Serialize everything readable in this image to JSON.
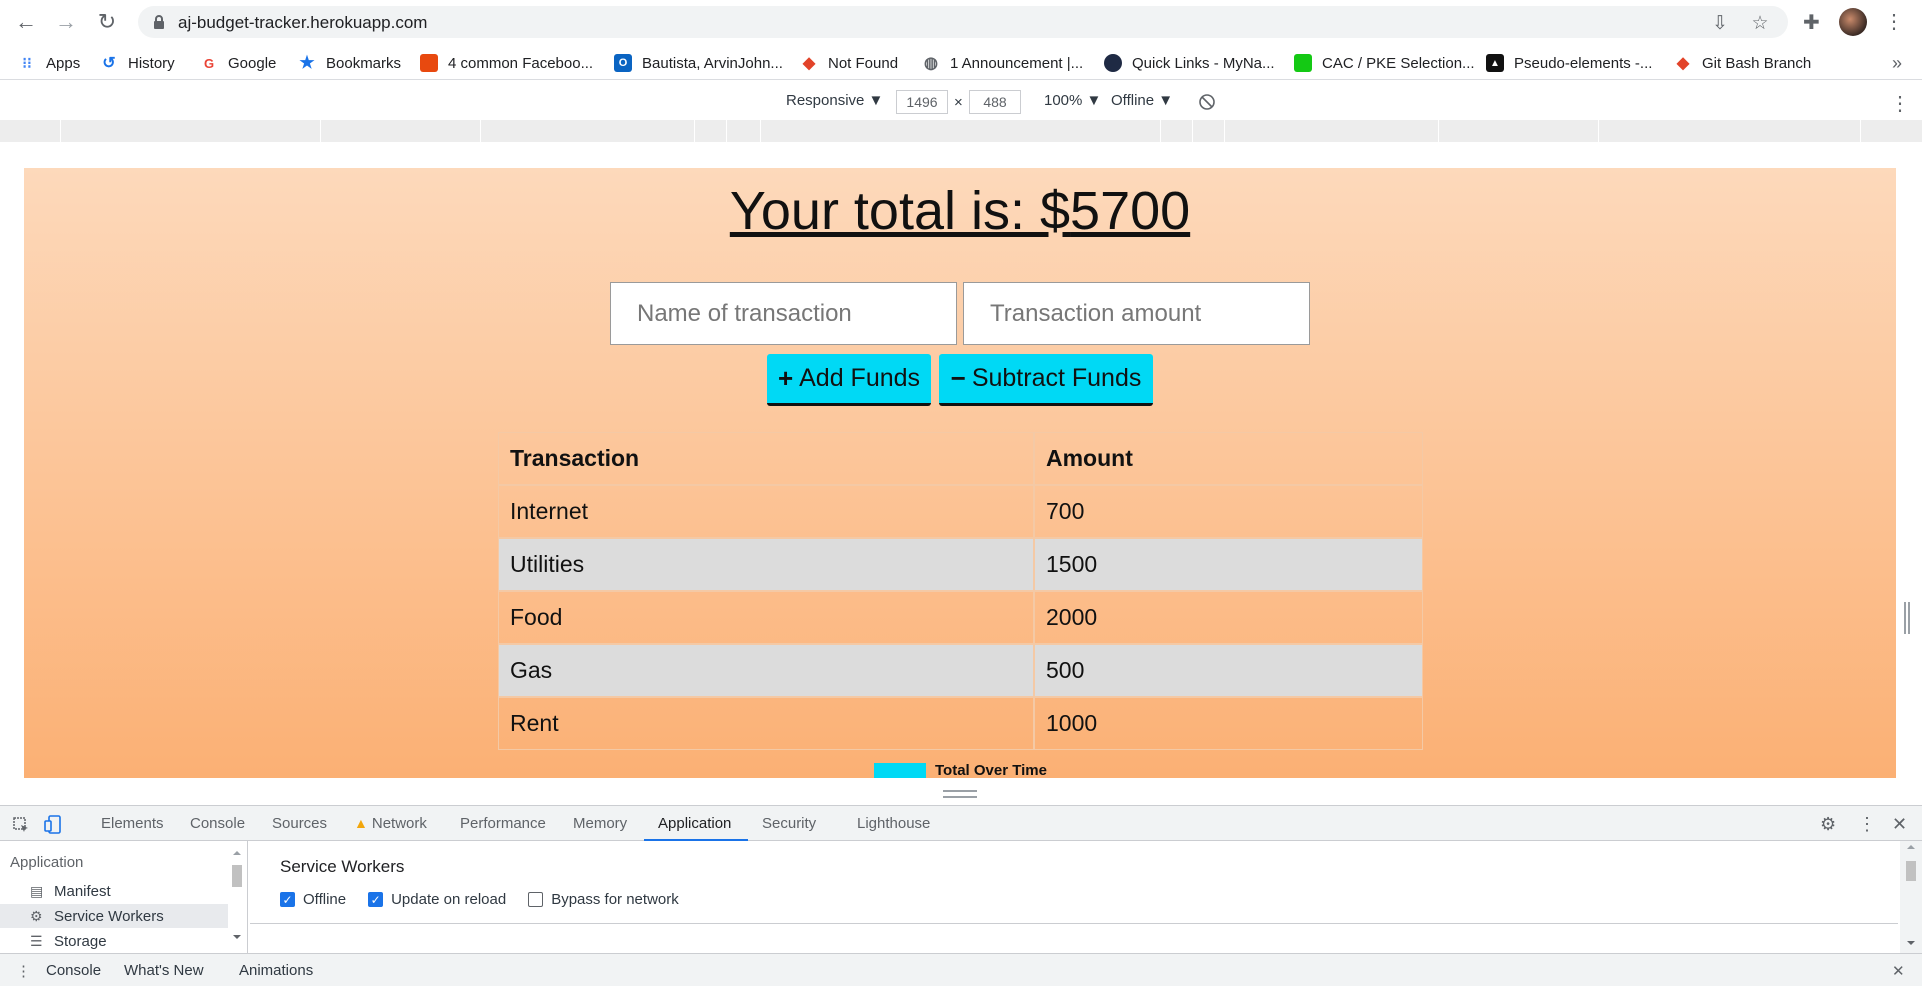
{
  "browser": {
    "url": "aj-budget-tracker.herokuapp.com",
    "bookmarks": [
      {
        "label": "Apps",
        "icon": "apps-grid-icon"
      },
      {
        "label": "History",
        "icon": "history-icon"
      },
      {
        "label": "Google",
        "icon": "google-icon"
      },
      {
        "label": "Bookmarks",
        "icon": "star-icon"
      },
      {
        "label": "4 common Faceboo...",
        "icon": "orange-square-icon"
      },
      {
        "label": "Bautista, ArvinJohn...",
        "icon": "outlook-icon"
      },
      {
        "label": "Not Found",
        "icon": "gitlab-icon"
      },
      {
        "label": "1 Announcement |...",
        "icon": "globe-icon"
      },
      {
        "label": "Quick Links - MyNa...",
        "icon": "navy-seal-icon"
      },
      {
        "label": "CAC / PKE Selection...",
        "icon": "cac-icon"
      },
      {
        "label": "Pseudo-elements -...",
        "icon": "mdn-icon"
      },
      {
        "label": "Git Bash Branch",
        "icon": "gitlab-icon"
      }
    ],
    "more_bookmarks": "»"
  },
  "device_toolbar": {
    "mode": "Responsive ▼",
    "width": "1496",
    "times": "×",
    "height": "488",
    "zoom": "100% ▼",
    "network": "Offline ▼"
  },
  "app": {
    "total_label": "Your total is: $",
    "total_value": "5700",
    "name_placeholder": "Name of transaction",
    "amount_placeholder": "Transaction amount",
    "add_button": {
      "symbol": "+",
      "label": "Add Funds"
    },
    "subtract_button": {
      "symbol": "−",
      "label": "Subtract Funds"
    },
    "table": {
      "headers": [
        "Transaction",
        "Amount"
      ],
      "rows": [
        [
          "Internet",
          "700"
        ],
        [
          "Utilities",
          "1500"
        ],
        [
          "Food",
          "2000"
        ],
        [
          "Gas",
          "500"
        ],
        [
          "Rent",
          "1000"
        ]
      ]
    },
    "chart_legend": "Total Over Time",
    "accent_color": "#00d9f5"
  },
  "devtools": {
    "tabs": [
      "Elements",
      "Console",
      "Sources",
      "Network",
      "Performance",
      "Memory",
      "Application",
      "Security",
      "Lighthouse"
    ],
    "active_tab": "Application",
    "network_warning_icon": "warning-icon",
    "sidebar": {
      "heading": "Application",
      "items": [
        {
          "label": "Manifest",
          "icon": "file-icon"
        },
        {
          "label": "Service Workers",
          "icon": "gear-icon"
        },
        {
          "label": "Storage",
          "icon": "database-icon"
        }
      ],
      "selected": "Service Workers"
    },
    "service_workers": {
      "title": "Service Workers",
      "offline_label": "Offline",
      "offline_checked": true,
      "update_label": "Update on reload",
      "update_checked": true,
      "bypass_label": "Bypass for network",
      "bypass_checked": false
    },
    "drawer_tabs": [
      "Console",
      "What's New",
      "Animations"
    ]
  }
}
